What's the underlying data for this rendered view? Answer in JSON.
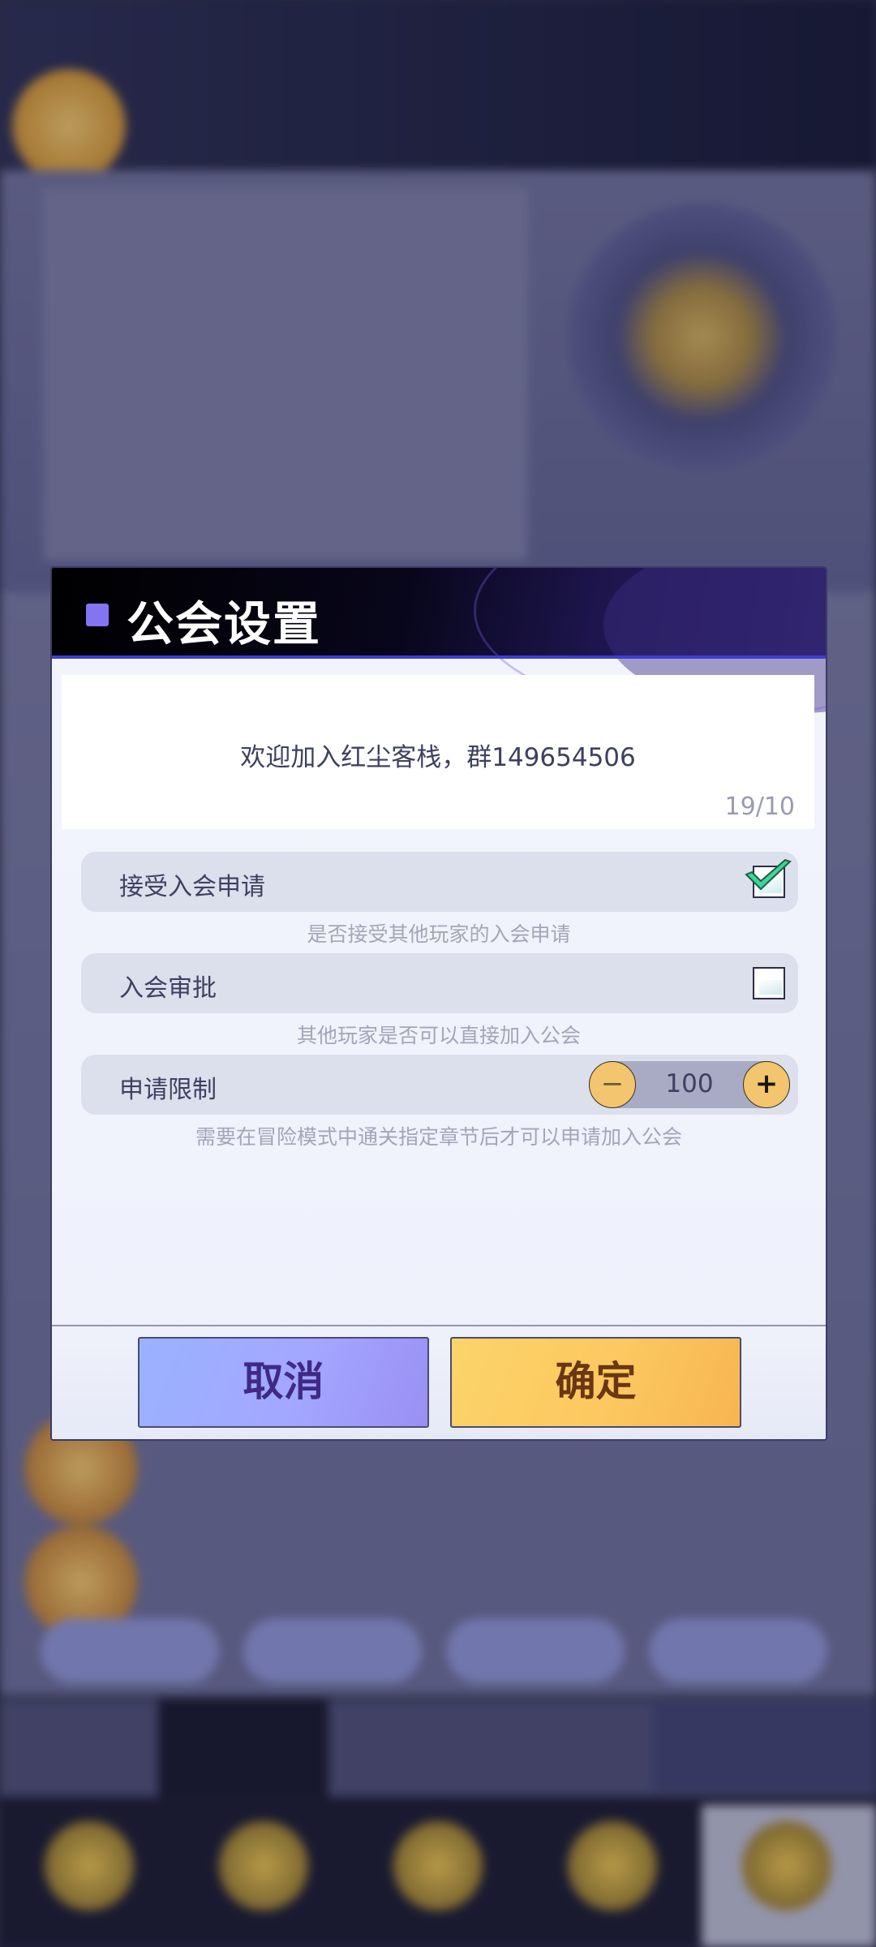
{
  "dialog": {
    "title": "公会设置",
    "notice": {
      "text": "欢迎加入红尘客栈，群149654506",
      "counter": "19/10"
    },
    "settings": [
      {
        "label": "接受入会申请",
        "hint": "是否接受其他玩家的入会申请",
        "checked": true
      },
      {
        "label": "入会审批",
        "hint": "其他玩家是否可以直接加入公会",
        "checked": false
      },
      {
        "label": "申请限制",
        "hint": "需要在冒险模式中通关指定章节后才可以申请加入公会",
        "value": "100",
        "minus": "−",
        "plus": "+"
      }
    ],
    "buttons": {
      "cancel": "取消",
      "confirm": "确定"
    }
  },
  "colors": {
    "accent_square": "#8375f2",
    "check_mark": "#3fd59a",
    "cancel_button": "#a3a7ff",
    "confirm_button": "#fcc85f"
  }
}
